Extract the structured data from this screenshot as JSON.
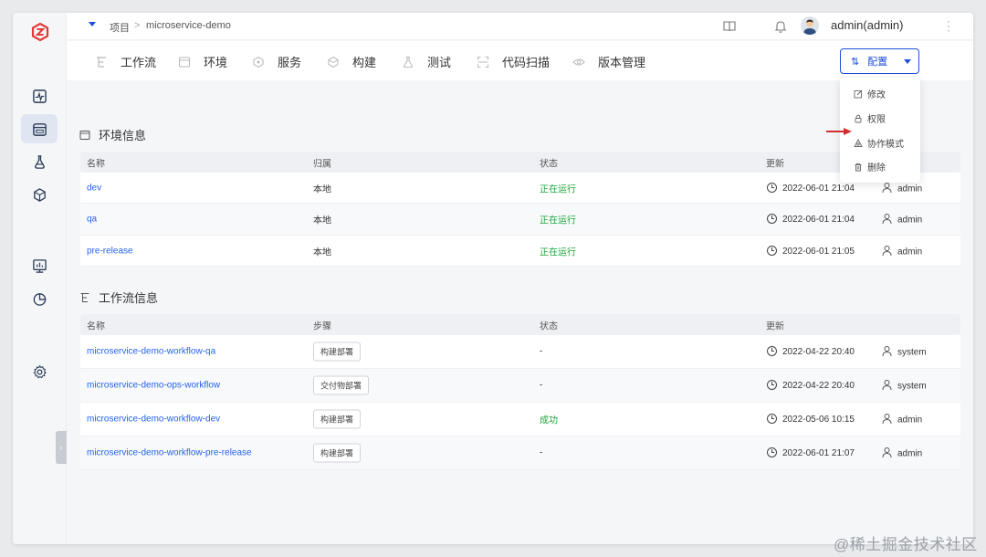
{
  "topbar": {
    "breadcrumb_root": "项目",
    "breadcrumb_sep": ">",
    "breadcrumb_current": "microservice-demo",
    "user": "admin(admin)"
  },
  "tabs": [
    {
      "label": "工作流",
      "icon": "workflow-icon"
    },
    {
      "label": "环境",
      "icon": "environment-icon"
    },
    {
      "label": "服务",
      "icon": "service-icon"
    },
    {
      "label": "构建",
      "icon": "build-icon"
    },
    {
      "label": "测试",
      "icon": "test-icon"
    },
    {
      "label": "代码扫描",
      "icon": "code-scan-icon"
    },
    {
      "label": "版本管理",
      "icon": "version-icon"
    }
  ],
  "config_button": {
    "label": "配置"
  },
  "config_menu": [
    {
      "label": "修改",
      "icon": "edit-icon"
    },
    {
      "label": "权限",
      "icon": "lock-icon"
    },
    {
      "label": "协作模式",
      "icon": "collaboration-icon"
    },
    {
      "label": "删除",
      "icon": "delete-icon"
    }
  ],
  "env_section": {
    "title": "环境信息",
    "columns": [
      "名称",
      "归属",
      "状态",
      "更新"
    ],
    "rows": [
      {
        "name": "dev",
        "owner": "本地",
        "status": "正在运行",
        "updated": "2022-06-01 21:04",
        "user": "admin"
      },
      {
        "name": "qa",
        "owner": "本地",
        "status": "正在运行",
        "updated": "2022-06-01 21:04",
        "user": "admin"
      },
      {
        "name": "pre-release",
        "owner": "本地",
        "status": "正在运行",
        "updated": "2022-06-01 21:05",
        "user": "admin"
      }
    ]
  },
  "workflow_section": {
    "title": "工作流信息",
    "columns": [
      "名称",
      "步骤",
      "状态",
      "更新"
    ],
    "rows": [
      {
        "name": "microservice-demo-workflow-qa",
        "step": "构建部署",
        "status": "-",
        "updated": "2022-04-22 20:40",
        "user": "system"
      },
      {
        "name": "microservice-demo-ops-workflow",
        "step": "交付物部署",
        "status": "-",
        "updated": "2022-04-22 20:40",
        "user": "system"
      },
      {
        "name": "microservice-demo-workflow-dev",
        "step": "构建部署",
        "status": "成功",
        "updated": "2022-05-06 10:15",
        "user": "admin"
      },
      {
        "name": "microservice-demo-workflow-pre-release",
        "step": "构建部署",
        "status": "-",
        "updated": "2022-06-01 21:07",
        "user": "admin"
      }
    ]
  },
  "watermark": "@稀土掘金技术社区",
  "colors": {
    "accent": "#1d4ed8",
    "link": "#2563eb",
    "success": "#22a33a",
    "logo": "#e53935",
    "arrow": "#d32f2f"
  }
}
